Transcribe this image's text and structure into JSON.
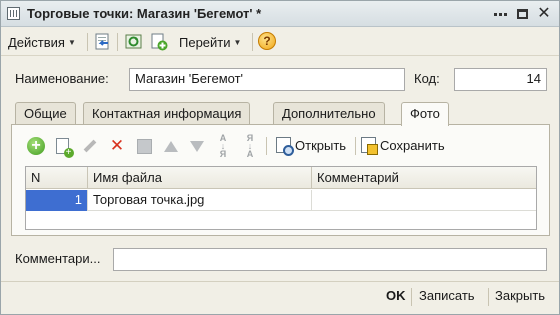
{
  "window": {
    "title": "Торговые точки: Магазин 'Бегемот' *"
  },
  "toolbar": {
    "actions_label": "Действия",
    "goto_label": "Перейти"
  },
  "form": {
    "name_label": "Наименование:",
    "name_value": "Магазин 'Бегемот'",
    "code_label": "Код:",
    "code_value": "14",
    "comment_label": "Комментари...",
    "comment_value": ""
  },
  "tabs": [
    {
      "label": "Общие",
      "active": false
    },
    {
      "label": "Контактная информация",
      "active": false
    },
    {
      "label": "Дополнительно",
      "active": false
    },
    {
      "label": "Фото",
      "active": true
    }
  ],
  "photo_toolbar": {
    "open_label": "Открыть",
    "save_label": "Сохранить"
  },
  "table": {
    "columns": [
      "N",
      "Имя файла",
      "Комментарий"
    ],
    "rows": [
      {
        "n": "1",
        "filename": "Торговая точка.jpg",
        "comment": ""
      }
    ]
  },
  "footer": {
    "ok_label": "OK",
    "write_label": "Записать",
    "close_label": "Закрыть"
  },
  "colors": {
    "selection": "#3e6ed1",
    "window_bg": "#f1efe6"
  }
}
